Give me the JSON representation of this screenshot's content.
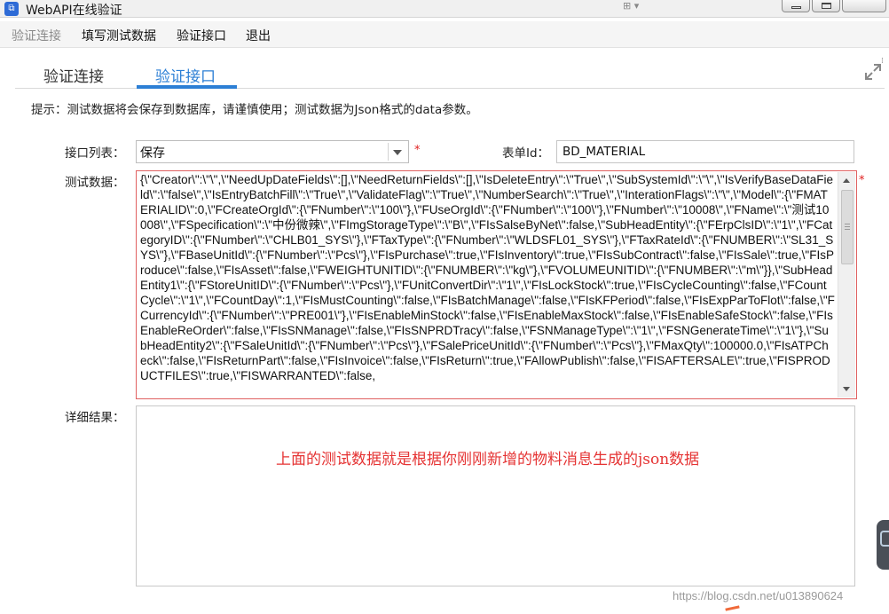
{
  "window": {
    "title": "WebAPI在线验证",
    "icon": "app-icon"
  },
  "menu": {
    "items": [
      {
        "label": "验证连接",
        "enabled": false
      },
      {
        "label": "填写测试数据",
        "enabled": true
      },
      {
        "label": "验证接口",
        "enabled": true
      },
      {
        "label": "退出",
        "enabled": true
      }
    ]
  },
  "tabs": [
    {
      "label": "验证连接",
      "active": false
    },
    {
      "label": "验证接口",
      "active": true
    }
  ],
  "hint": "提示：测试数据将会保存到数据库，请谨慎使用；测试数据为Json格式的data参数。",
  "form": {
    "interface_list_label": "接口列表：",
    "interface_list_value": "保存",
    "form_id_label": "表单Id：",
    "form_id_value": "BD_MATERIAL",
    "test_data_label": "测试数据：",
    "result_label": "详细结果：",
    "required_mark": "*",
    "test_data": "{\\\"Creator\\\":\\\"\\\",\\\"NeedUpDateFields\\\":[],\\\"NeedReturnFields\\\":[],\\\"IsDeleteEntry\\\":\\\"True\\\",\\\"SubSystemId\\\":\\\"\\\",\\\"IsVerifyBaseDataField\\\":\\\"false\\\",\\\"IsEntryBatchFill\\\":\\\"True\\\",\\\"ValidateFlag\\\":\\\"True\\\",\\\"NumberSearch\\\":\\\"True\\\",\\\"InterationFlags\\\":\\\"\\\",\\\"Model\\\":{\\\"FMATERIALID\\\":0,\\\"FCreateOrgId\\\":{\\\"FNumber\\\":\\\"100\\\"},\\\"FUseOrgId\\\":{\\\"FNumber\\\":\\\"100\\\"},\\\"FNumber\\\":\\\"10008\\\",\\\"FName\\\":\\\"测试10008\\\",\\\"FSpecification\\\":\\\"中份微辣\\\",\\\"FImgStorageType\\\":\\\"B\\\",\\\"FIsSalseByNet\\\":false,\\\"SubHeadEntity\\\":{\\\"FErpClsID\\\":\\\"1\\\",\\\"FCategoryID\\\":{\\\"FNumber\\\":\\\"CHLB01_SYS\\\"},\\\"FTaxType\\\":{\\\"FNumber\\\":\\\"WLDSFL01_SYS\\\"},\\\"FTaxRateId\\\":{\\\"FNUMBER\\\":\\\"SL31_SYS\\\"},\\\"FBaseUnitId\\\":{\\\"FNumber\\\":\\\"Pcs\\\"},\\\"FIsPurchase\\\":true,\\\"FIsInventory\\\":true,\\\"FIsSubContract\\\":false,\\\"FIsSale\\\":true,\\\"FIsProduce\\\":false,\\\"FIsAsset\\\":false,\\\"FWEIGHTUNITID\\\":{\\\"FNUMBER\\\":\\\"kg\\\"},\\\"FVOLUMEUNITID\\\":{\\\"FNUMBER\\\":\\\"m\\\"}},\\\"SubHeadEntity1\\\":{\\\"FStoreUnitID\\\":{\\\"FNumber\\\":\\\"Pcs\\\"},\\\"FUnitConvertDir\\\":\\\"1\\\",\\\"FIsLockStock\\\":true,\\\"FIsCycleCounting\\\":false,\\\"FCountCycle\\\":\\\"1\\\",\\\"FCountDay\\\":1,\\\"FIsMustCounting\\\":false,\\\"FIsBatchManage\\\":false,\\\"FIsKFPeriod\\\":false,\\\"FIsExpParToFlot\\\":false,\\\"FCurrencyId\\\":{\\\"FNumber\\\":\\\"PRE001\\\"},\\\"FIsEnableMinStock\\\":false,\\\"FIsEnableMaxStock\\\":false,\\\"FIsEnableSafeStock\\\":false,\\\"FIsEnableReOrder\\\":false,\\\"FIsSNManage\\\":false,\\\"FIsSNPRDTracy\\\":false,\\\"FSNManageType\\\":\\\"1\\\",\\\"FSNGenerateTime\\\":\\\"1\\\"},\\\"SubHeadEntity2\\\":{\\\"FSaleUnitId\\\":{\\\"FNumber\\\":\\\"Pcs\\\"},\\\"FSalePriceUnitId\\\":{\\\"FNumber\\\":\\\"Pcs\\\"},\\\"FMaxQty\\\":100000.0,\\\"FIsATPCheck\\\":false,\\\"FIsReturnPart\\\":false,\\\"FIsInvoice\\\":false,\\\"FIsReturn\\\":true,\\\"FAllowPublish\\\":false,\\\"FISAFTERSALE\\\":true,\\\"FISPRODUCTFILES\\\":true,\\\"FISWARRANTED\\\":false,"
  },
  "annotation": "上面的测试数据就是根据你刚刚新增的物料消息生成的json数据",
  "watermark": "https://blog.csdn.net/u013890624",
  "colors": {
    "accent": "#2c7fd5",
    "annotation": "#e53333",
    "required": "#e02020"
  }
}
